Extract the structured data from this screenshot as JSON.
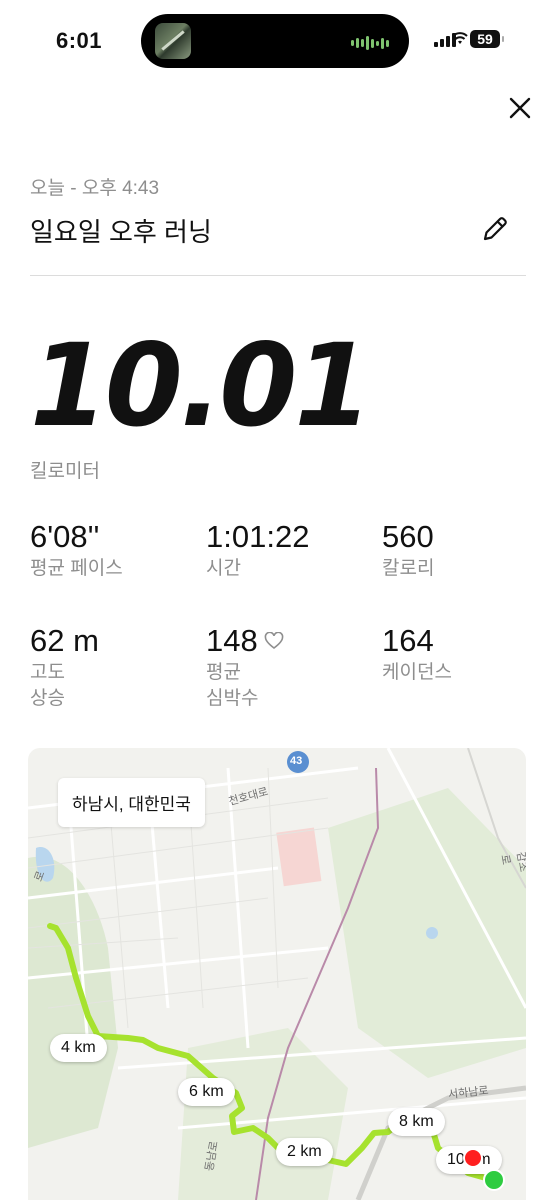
{
  "status_bar": {
    "time": "6:01",
    "battery": "59"
  },
  "header": {
    "date_line": "오늘 - 오후 4:43",
    "title": "일요일 오후 러닝"
  },
  "summary": {
    "distance": "10.01",
    "distance_unit": "킬로미터"
  },
  "stats": [
    {
      "value": "6'08''",
      "label": "평균 페이스"
    },
    {
      "value": "1:01:22",
      "label": "시간"
    },
    {
      "value": "560",
      "label": "칼로리"
    },
    {
      "value": "62 m",
      "label": "고도\n상승"
    },
    {
      "value": "148",
      "label": "평균\n심박수",
      "icon": "heart-outline-icon"
    },
    {
      "value": "164",
      "label": "케이던스"
    }
  ],
  "map": {
    "location": "하남시, 대한민국",
    "km_markers": [
      "4 km",
      "6 km",
      "2 km",
      "8 km",
      "10 km"
    ],
    "road_labels": [
      "천호대로",
      "43",
      "서하남로",
      "감초로",
      "동남로",
      "로"
    ],
    "route_color": "#a6e22e",
    "start_color": "#2ecc40",
    "end_color": "#ff1f1f"
  },
  "icons": {
    "close": "close-icon",
    "edit": "pencil-icon",
    "heart": "heart-outline-icon"
  }
}
